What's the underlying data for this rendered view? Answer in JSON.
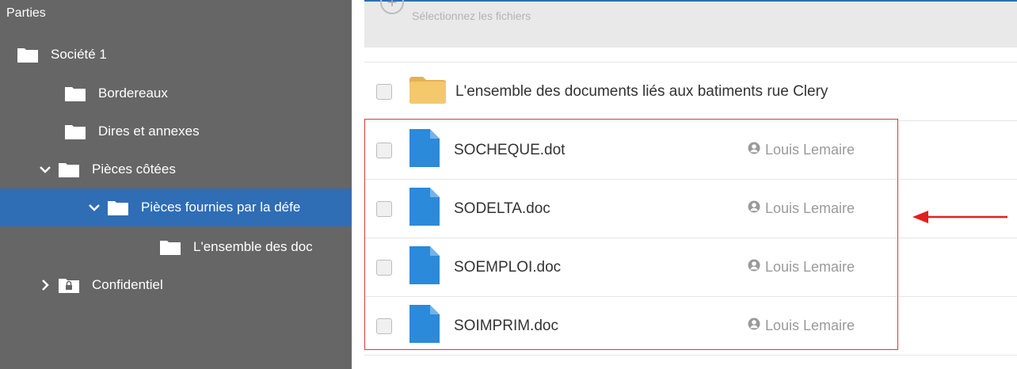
{
  "sidebar": {
    "header": "Parties",
    "items": [
      {
        "label": "Société 1"
      },
      {
        "label": "Bordereaux"
      },
      {
        "label": "Dires et annexes"
      },
      {
        "label": "Pièces côtées"
      },
      {
        "label": "Pièces fournies par la défe"
      },
      {
        "label": "L'ensemble des doc"
      },
      {
        "label": "Confidentiel"
      }
    ]
  },
  "toolbar": {
    "select_files_label": "Sélectionnez les fichiers"
  },
  "files": {
    "folder_row": {
      "title": "L'ensemble des documents liés aux batiments rue Clery"
    },
    "rows": [
      {
        "name": "SOCHEQUE.dot",
        "owner": "Louis Lemaire"
      },
      {
        "name": "SODELTA.doc",
        "owner": "Louis Lemaire"
      },
      {
        "name": "SOEMPLOI.doc",
        "owner": "Louis Lemaire"
      },
      {
        "name": "SOIMPRIM.doc",
        "owner": "Louis Lemaire"
      }
    ]
  },
  "colors": {
    "sidebar_bg": "#666666",
    "selected_bg": "#2f6db5",
    "file_icon": "#2b8ad9",
    "folder_icon": "#f0c060",
    "annotation_red": "#d9383d"
  }
}
